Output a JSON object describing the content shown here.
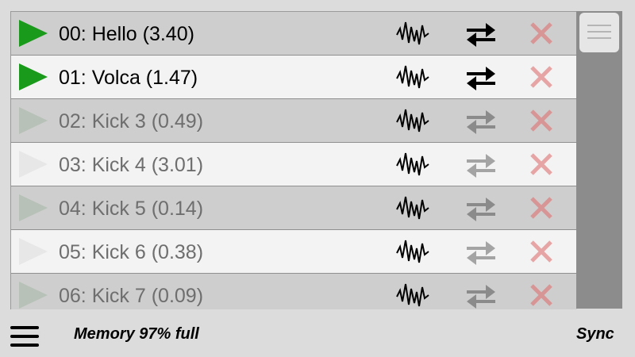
{
  "rows": [
    {
      "label": "00: Hello (3.40)",
      "active": true
    },
    {
      "label": "01: Volca (1.47)",
      "active": true
    },
    {
      "label": "02: Kick 3 (0.49)",
      "active": false
    },
    {
      "label": "03: Kick 4 (3.01)",
      "active": false
    },
    {
      "label": "04: Kick 5 (0.14)",
      "active": false
    },
    {
      "label": "05: Kick 6 (0.38)",
      "active": false
    },
    {
      "label": "06: Kick 7 (0.09)",
      "active": false
    }
  ],
  "footer": {
    "memory_text": "Memory 97% full",
    "sync_label": "Sync"
  },
  "icons": {
    "play": "play-icon",
    "waveform": "waveform-icon",
    "swap": "swap-arrows-icon",
    "delete": "delete-x-icon",
    "menu": "hamburger-menu-icon",
    "scroll_handle": "scroll-handle-grip-icon"
  },
  "colors": {
    "play_active": "#1a9a1a",
    "delete_red": "#e07070",
    "scroll_track": "#8c8c8c"
  }
}
